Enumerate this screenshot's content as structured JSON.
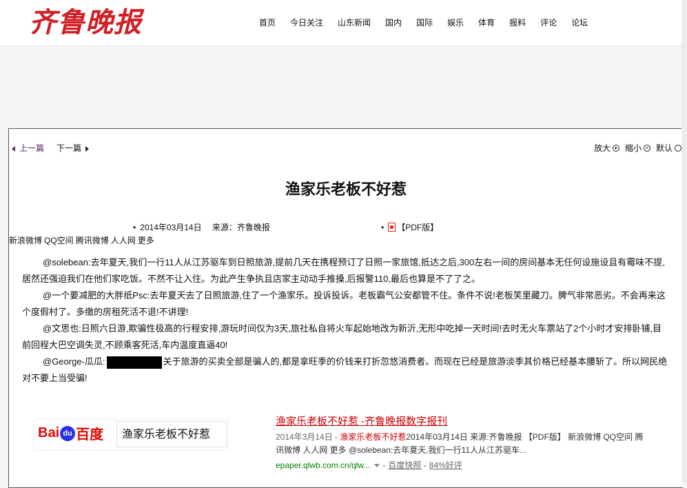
{
  "brand": {
    "logo_text": "齐鲁晚报",
    "accent": "#d01f25"
  },
  "nav": {
    "items": [
      "首页",
      "今日关注",
      "山东新闻",
      "国内",
      "国际",
      "娱乐",
      "体育",
      "报料",
      "评论",
      "论坛"
    ]
  },
  "pager": {
    "prev": "上一篇",
    "next": "下一篇"
  },
  "zoom": {
    "enlarge": "放大",
    "shrink": "缩小",
    "default": "默认"
  },
  "article": {
    "title": "渔家乐老板不好惹",
    "meta": "2014年03月14日　 来源：齐鲁晚报",
    "pdf": "【PDF版】",
    "share": [
      "新浪微博",
      "QQ空间",
      "腾讯微博",
      "人人网",
      "更多"
    ],
    "paragraphs": [
      "@solebean:去年夏天,我们一行11人从江苏驱车到日照旅游,提前几天在携程预订了日照一家旅馆,抵达之后,300左右一间的房间基本无任何设施设且有霉味不提,居然还强迫我们在他们家吃饭。不然不让入住。为此产生争执且店家主动动手推搡,后报警110,最后也算是不了了之。",
      "@一个要减肥的大胖纸Psc:去年夏天去了日照旅游,住了一个渔家乐。投诉投诉。老板霸气公安都管不住。条件不说!老板笑里藏刀。脾气非常恶劣。不会再来这个度假村了。多缴的房租死活不退!不讲理!",
      "@文思也:日照六日游,欺骗性极高的行程安排,游玩时间仅为3天,旅社私自将火车起始地改为新沂,无形中吃掉一天时间!去时无火车票站了2个小时才安排卧铺,目前回程大巴空调失灵,不顾乘客死活,车内温度直逼40!"
    ],
    "para4_prefix": "@George-瓜瓜:",
    "para4_rest": "关于旅游的买卖全部是骗人的,都是拿旺季的价钱来打折忽悠消费者。而现在已经是旅游淡季其价格已经基本腰斩了。所以网民绝对不要上当受骗!"
  },
  "baidu": {
    "logo_left": "Bai",
    "logo_paw": "du",
    "logo_right": "百度",
    "query": "渔家乐老板不好惹"
  },
  "search_result": {
    "title": "渔家乐老板不好惹 -齐鲁晚报数字报刊",
    "date": "2014年3月14日 - ",
    "highlight": "渔家乐老板不好惹",
    "snippet": "2014年03月14日 来源:齐鲁晚报 【PDF版】 新浪微博 QQ空间 腾讯微博 人人网 更多 @solebean:去年夏天,我们一行11人从江苏驱车...",
    "url": "epaper.qlwb.com.cn/qlw...",
    "cache": "百度快照",
    "rating": "84%好评"
  }
}
